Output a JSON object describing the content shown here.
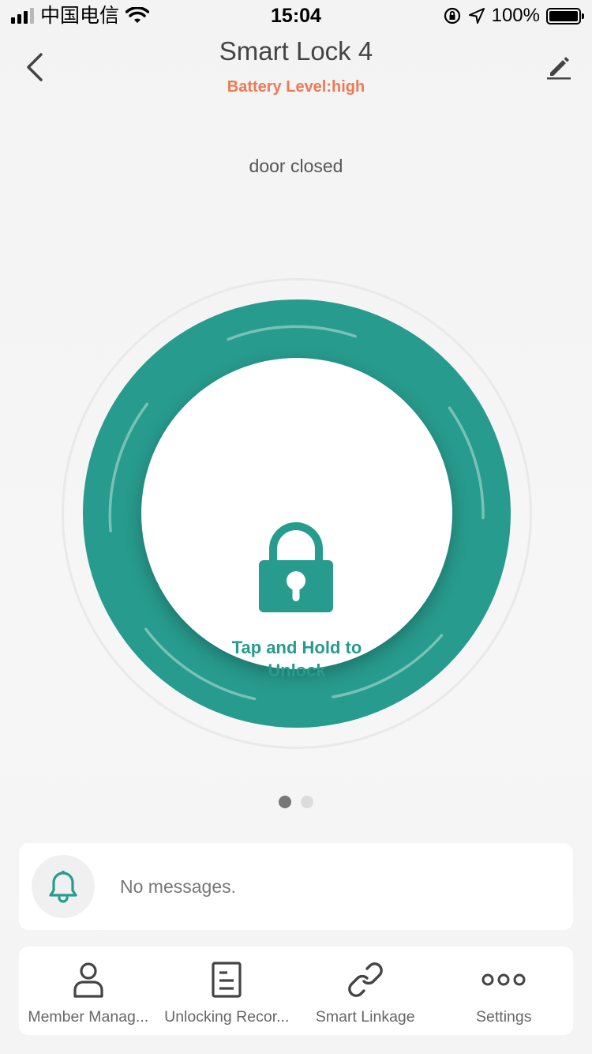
{
  "status_bar": {
    "carrier": "中国电信",
    "time": "15:04",
    "battery_percent": "100%"
  },
  "header": {
    "title": "Smart Lock 4",
    "battery_level": "Battery Level:high"
  },
  "door_status": "door closed",
  "lock_button": {
    "label_line1": "Tap and Hold to",
    "label_line2": "Unlock"
  },
  "pager": {
    "pages": 2,
    "current": 1
  },
  "messages": {
    "text": "No messages."
  },
  "bottom_nav": [
    {
      "label": "Member Manag...",
      "icon": "person-icon"
    },
    {
      "label": "Unlocking Recor...",
      "icon": "document-icon"
    },
    {
      "label": "Smart Linkage",
      "icon": "link-icon"
    },
    {
      "label": "Settings",
      "icon": "more-icon"
    }
  ],
  "colors": {
    "accent": "#279b8d",
    "battery_text": "#ee7a55",
    "background": "#f4f4f4"
  }
}
